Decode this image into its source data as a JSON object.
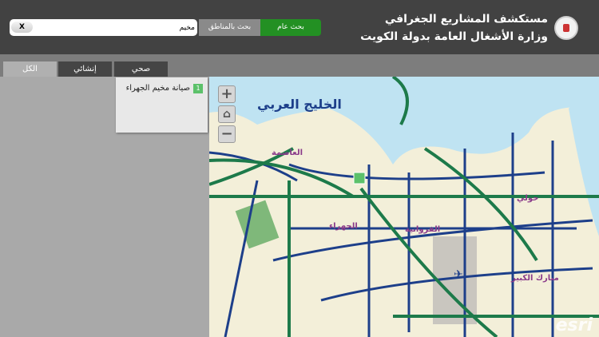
{
  "header": {
    "title_line1": "مستكشف المشاريع الجغرافي",
    "title_line2": "وزارة الأشغال العامة بدولة الكويت"
  },
  "search": {
    "value": "مخيم",
    "clear_label": "X",
    "area_search_label": "بحث بالمناطق",
    "general_search_label": "بحث عام"
  },
  "tabs": [
    {
      "label": "الكل",
      "active": true
    },
    {
      "label": "إنشائي"
    },
    {
      "label": "صحي"
    }
  ],
  "results": [
    {
      "number": "1",
      "label": "صيانة مخيم الجهراء"
    }
  ],
  "map": {
    "zoom_in": "+",
    "home": "⌂",
    "zoom_out": "−",
    "attribution": "esri",
    "labels": {
      "sea": "الخليج العربي",
      "capital": "العاصمة",
      "jahra": "الجهراء",
      "hawalli": "حولي",
      "farwaniya": "الفروانية",
      "mubarak": "مبارك الكبير"
    },
    "colors": {
      "sea": "#bfe3f2",
      "land": "#f3efd9",
      "road": "#1d3f8a",
      "highway": "#1d7a4a",
      "park": "#7fb87a"
    }
  }
}
